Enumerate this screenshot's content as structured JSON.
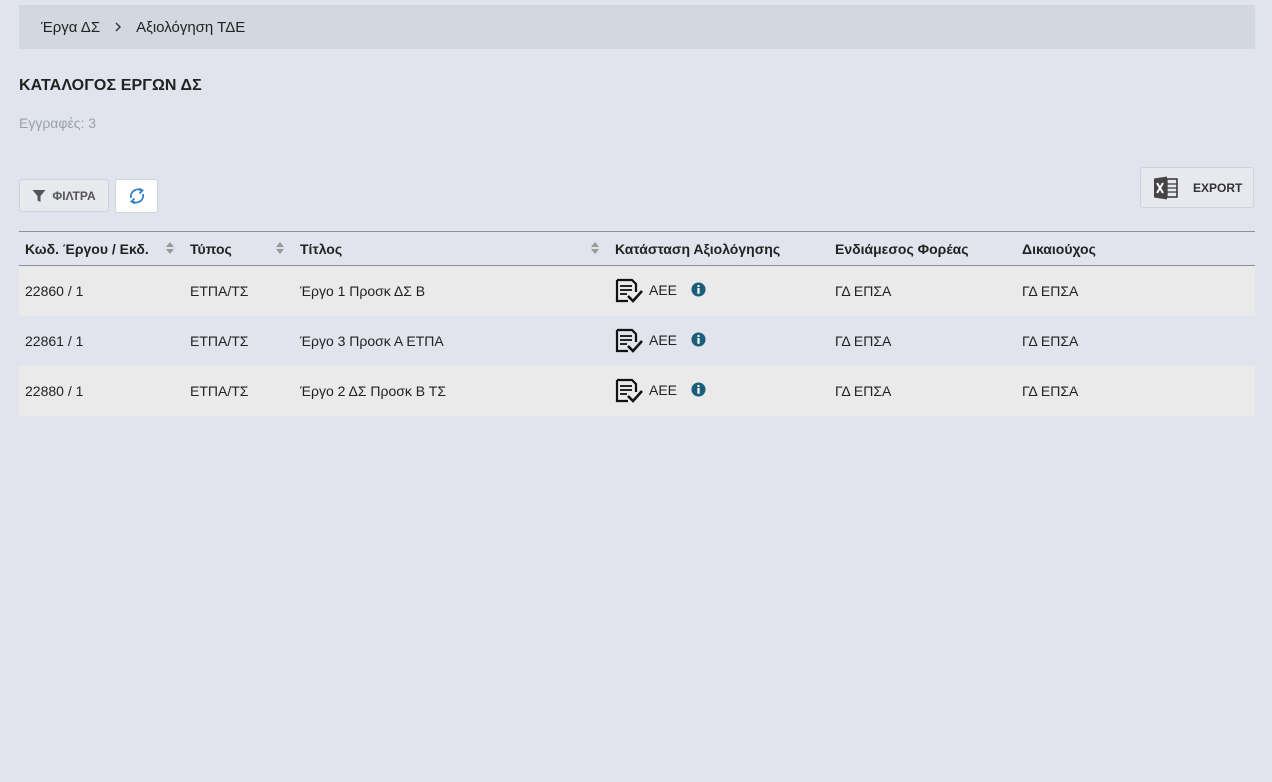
{
  "breadcrumb": {
    "items": [
      "Έργα ΔΣ",
      "Αξιολόγηση ΤΔΕ"
    ]
  },
  "page": {
    "title": "ΚΑΤΑΛΟΓΟΣ ΕΡΓΩΝ ΔΣ",
    "count_label": "Εγγραφές: 3"
  },
  "toolbar": {
    "filters_label": "ΦΙΛΤΡΑ",
    "filter_icon": "filter-icon",
    "refresh_icon": "refresh-icon",
    "export_label": "EXPORT",
    "export_icon": "excel-icon"
  },
  "table": {
    "columns": [
      "Κωδ. Έργου / Εκδ.",
      "Τύπος",
      "Τίτλος",
      "Κατάσταση Αξιολόγησης",
      "Ενδιάμεσος Φορέας",
      "Δικαιούχος"
    ],
    "rows": [
      {
        "code": "22860 / 1",
        "type": "ΕΤΠΑ/ΤΣ",
        "title": "Έργο 1 Προσκ ΔΣ Β",
        "status": "ΑΕΕ",
        "intermediate": "ΓΔ ΕΠΣΑ",
        "beneficiary": "ΓΔ ΕΠΣΑ"
      },
      {
        "code": "22861 / 1",
        "type": "ΕΤΠΑ/ΤΣ",
        "title": "Έργο 3 Προσκ Α ΕΤΠΑ",
        "status": "ΑΕΕ",
        "intermediate": "ΓΔ ΕΠΣΑ",
        "beneficiary": "ΓΔ ΕΠΣΑ"
      },
      {
        "code": "22880 / 1",
        "type": "ΕΤΠΑ/ΤΣ",
        "title": "Έργο 2 ΔΣ Προσκ Β ΤΣ",
        "status": "ΑΕΕ",
        "intermediate": "ΓΔ ΕΠΣΑ",
        "beneficiary": "ΓΔ ΕΠΣΑ"
      }
    ]
  },
  "colors": {
    "background": "#e1e4ec",
    "breadcrumb_bg": "#d3d7e0",
    "info_icon": "#1a5f7a",
    "refresh_icon": "#2f7fc1"
  }
}
